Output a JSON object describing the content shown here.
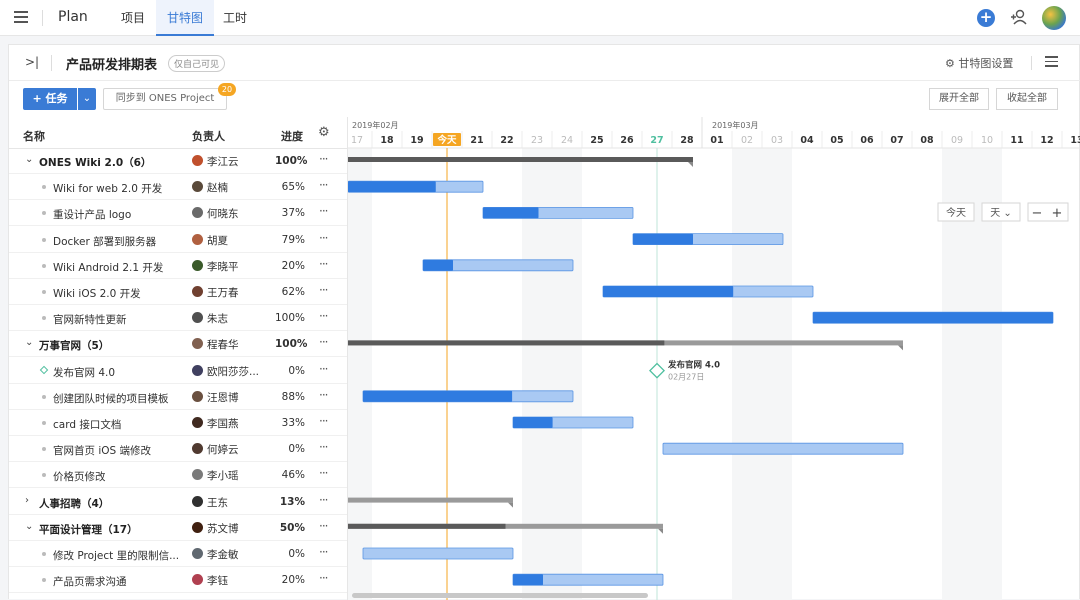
{
  "topbar": {
    "app_name": "Plan",
    "tabs": [
      {
        "label": "项目",
        "active": false
      },
      {
        "label": "甘特图",
        "active": true
      },
      {
        "label": "工时",
        "active": false
      }
    ],
    "accent": "#3a7bd5"
  },
  "header": {
    "title": "产品研发排期表",
    "visibility_badge": "仅自己可见",
    "settings_label": "甘特图设置"
  },
  "toolbar": {
    "task_button": "+ 任务",
    "sync_button": "同步到 ONES Project",
    "sync_count": "20",
    "expand_all": "展开全部",
    "collapse_all": "收起全部"
  },
  "columns": {
    "name": "名称",
    "owner": "负责人",
    "progress": "进度"
  },
  "rows": [
    {
      "name": "ONES Wiki 2.0（6）",
      "owner": "李江云",
      "progress": "100%",
      "group": true,
      "expanded": true,
      "avatar_color": "#c0502d",
      "bar": {
        "start": 0,
        "end": 11.5,
        "done": 1.0
      }
    },
    {
      "name": "Wiki for web 2.0 开发",
      "owner": "赵楠",
      "progress": "65%",
      "group": false,
      "avatar_color": "#5a4a3a",
      "bar": {
        "start": 0,
        "end": 4.5,
        "done": 0.65
      }
    },
    {
      "name": "重设计产品 logo",
      "owner": "何晓东",
      "progress": "37%",
      "group": false,
      "avatar_color": "#6a6a6a",
      "bar": {
        "start": 4.5,
        "end": 9.5,
        "done": 0.37
      }
    },
    {
      "name": "Docker 部署到服务器",
      "owner": "胡夏",
      "progress": "79%",
      "group": false,
      "avatar_color": "#b06040",
      "bar": {
        "start": 9.5,
        "end": 14.5,
        "done": 0.4
      }
    },
    {
      "name": "Wiki Android 2.1 开发",
      "owner": "李晓平",
      "progress": "20%",
      "group": false,
      "avatar_color": "#3a5a2a",
      "bar": {
        "start": 2.5,
        "end": 7.5,
        "done": 0.2
      }
    },
    {
      "name": "Wiki iOS 2.0 开发",
      "owner": "王万春",
      "progress": "62%",
      "group": false,
      "avatar_color": "#704030",
      "bar": {
        "start": 8.5,
        "end": 15.5,
        "done": 0.62
      }
    },
    {
      "name": "官网新特性更新",
      "owner": "朱志",
      "progress": "100%",
      "group": false,
      "avatar_color": "#505050",
      "bar": {
        "start": 15.5,
        "end": 23.5,
        "done": 1.0
      }
    },
    {
      "name": "万事官网（5）",
      "owner": "程春华",
      "progress": "100%",
      "group": true,
      "expanded": true,
      "avatar_color": "#806050",
      "bar": {
        "start": 0,
        "end": 18.5,
        "done": 0.57
      }
    },
    {
      "name": "发布官网 4.0",
      "owner": "欧阳莎莎...",
      "progress": "0%",
      "group": false,
      "milestone": true,
      "avatar_color": "#404060",
      "milestone_label": "发布官网 4.0",
      "milestone_date": "02月27日",
      "milestone_day": 10
    },
    {
      "name": "创建团队时候的项目模板",
      "owner": "汪恩博",
      "progress": "88%",
      "group": false,
      "avatar_color": "#6a5040",
      "bar": {
        "start": 0.5,
        "end": 7.5,
        "done": 0.71
      }
    },
    {
      "name": "card 接口文档",
      "owner": "李国燕",
      "progress": "33%",
      "group": false,
      "avatar_color": "#402a20",
      "bar": {
        "start": 5.5,
        "end": 9.5,
        "done": 0.33
      }
    },
    {
      "name": "官网首页 iOS 端修改",
      "owner": "何婷云",
      "progress": "0%",
      "group": false,
      "avatar_color": "#503a30",
      "bar": {
        "start": 10.5,
        "end": 18.5,
        "done": 0
      }
    },
    {
      "name": "价格页修改",
      "owner": "李小瑶",
      "progress": "46%",
      "group": false,
      "avatar_color": "#7a7a7a"
    },
    {
      "name": "人事招聘（4）",
      "owner": "王东",
      "progress": "13%",
      "group": true,
      "expanded": false,
      "avatar_color": "#303030",
      "bar": {
        "start": 0,
        "end": 5.5,
        "done": 0.13,
        "summary_gray": true
      }
    },
    {
      "name": "平面设计管理（17）",
      "owner": "苏文博",
      "progress": "50%",
      "group": true,
      "expanded": true,
      "avatar_color": "#402010",
      "bar": {
        "start": 0,
        "end": 10.5,
        "done": 0.5
      }
    },
    {
      "name": "修改 Project 里的限制信...",
      "owner": "李金敏",
      "progress": "0%",
      "group": false,
      "avatar_color": "#606870",
      "bar": {
        "start": 0.5,
        "end": 5.5,
        "done": 0
      }
    },
    {
      "name": "产品页需求沟通",
      "owner": "李钰",
      "progress": "20%",
      "group": false,
      "avatar_color": "#b04050",
      "bar": {
        "start": 5.5,
        "end": 10.5,
        "done": 0.2
      }
    }
  ],
  "timeline": {
    "months": [
      {
        "label": "2019年02月",
        "day_index": 0
      },
      {
        "label": "2019年03月",
        "day_index": 12
      }
    ],
    "days": [
      {
        "label": "17",
        "weekend": true
      },
      {
        "label": "18",
        "weekend": false
      },
      {
        "label": "19",
        "weekend": false
      },
      {
        "label": "今天",
        "weekend": false,
        "today": true
      },
      {
        "label": "21",
        "weekend": false
      },
      {
        "label": "22",
        "weekend": false
      },
      {
        "label": "23",
        "weekend": true
      },
      {
        "label": "24",
        "weekend": true
      },
      {
        "label": "25",
        "weekend": false
      },
      {
        "label": "26",
        "weekend": false
      },
      {
        "label": "27",
        "weekend": false,
        "highlight": true
      },
      {
        "label": "28",
        "weekend": false
      },
      {
        "label": "01",
        "weekend": false
      },
      {
        "label": "02",
        "weekend": true
      },
      {
        "label": "03",
        "weekend": true
      },
      {
        "label": "04",
        "weekend": false
      },
      {
        "label": "05",
        "weekend": false
      },
      {
        "label": "06",
        "weekend": false
      },
      {
        "label": "07",
        "weekend": false
      },
      {
        "label": "08",
        "weekend": false
      },
      {
        "label": "09",
        "weekend": true
      },
      {
        "label": "10",
        "weekend": true
      },
      {
        "label": "11",
        "weekend": false
      },
      {
        "label": "12",
        "weekend": false
      },
      {
        "label": "13",
        "weekend": false
      }
    ],
    "today_index": 3,
    "controls": {
      "today": "今天",
      "scale": "天",
      "zoom_out": "−",
      "zoom_in": "+"
    }
  },
  "colors": {
    "bar_done": "#2f7be0",
    "bar_todo": "#a9c9f3",
    "summary_dark": "#5a5a5a",
    "summary_gray": "#8a8a8a",
    "today_line": "#f5a623",
    "milestone": "#4fbf9f",
    "weekend": "#f5f6f7"
  }
}
